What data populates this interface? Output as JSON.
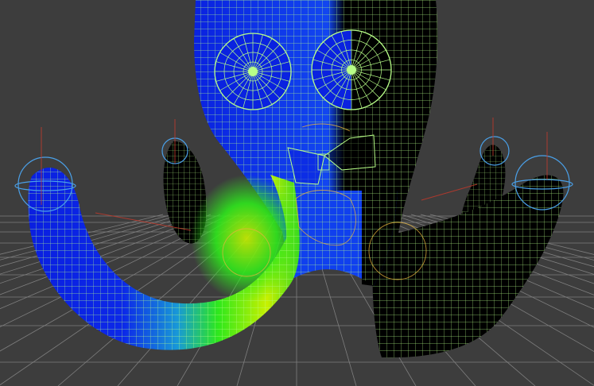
{
  "viewport": {
    "background_color": "#3d3d3d",
    "ground_grid_color": "#9a9a9a",
    "wireframe_color": "#b8ff88",
    "weight_colors": [
      "#0a1fe0",
      "#1550f0",
      "#18c8c0",
      "#2ee81c",
      "#c8f000",
      "#000000"
    ],
    "joint_color": "#4aa0e8",
    "bone_color": "#c0392b",
    "bowtie_color": "#e6b43c",
    "object": "octopus-character-mesh"
  }
}
